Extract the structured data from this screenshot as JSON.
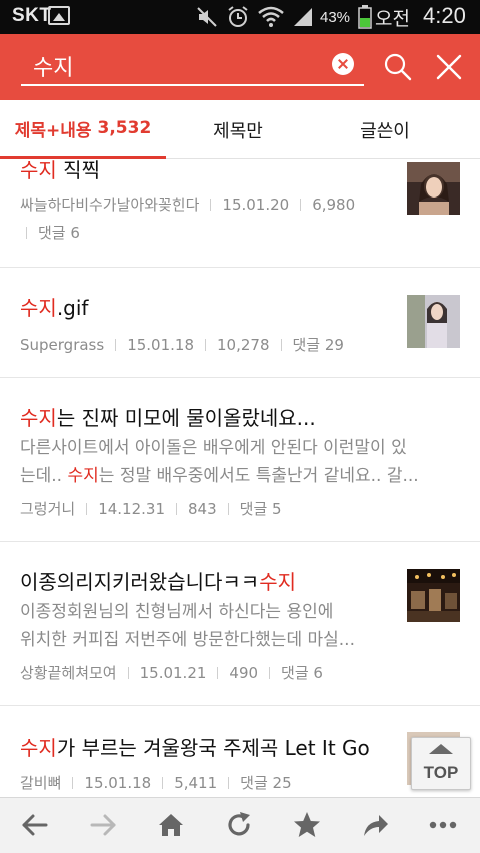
{
  "status_bar": {
    "carrier": "SKT",
    "battery_percent": "43%",
    "ampm": "오전",
    "time": "4:20"
  },
  "search": {
    "query": "수지",
    "icons": {
      "clear": "clear-icon",
      "search": "search-icon",
      "close": "close-icon"
    }
  },
  "tabs": [
    {
      "label": "제목+내용",
      "count": "3,532",
      "active": true
    },
    {
      "label": "제목만",
      "active": false
    },
    {
      "label": "글쓴이",
      "active": false
    }
  ],
  "results": [
    {
      "title_highlight": "수지",
      "title_rest": " 직찍",
      "author": "싸늘하다비수가날아와꽂힌다",
      "date": "15.01.20",
      "views": "6,980",
      "comments": "댓글 6"
    },
    {
      "title_highlight": "수지",
      "title_rest": ".gif",
      "author": "Supergrass",
      "date": "15.01.18",
      "views": "10,278",
      "comments": "댓글 29"
    },
    {
      "title_highlight": "수지",
      "title_rest": "는 진짜 미모에 물이올랐네요...",
      "snippet_line1": "다른사이트에서 아이돌은 배우에게 안된다 이런말이 있",
      "snippet_line2_pre": "는데.. ",
      "snippet_line2_hl": "수지",
      "snippet_line2_post": "는 정말 배우중에서도 특출난거 같네요.. 갈...",
      "author": "그렁거니",
      "date": "14.12.31",
      "views": "843",
      "comments": "댓글 5"
    },
    {
      "title_pre": "이종의리지키러왔습니다ㅋㅋ",
      "title_highlight": "수지",
      "snippet_line1": "이종정회원님의 친형님께서 하신다는 용인에",
      "snippet_line2": "위치한 커피집 저번주에 방문한다했는데 마실...",
      "author": "상황끝헤쳐모여",
      "date": "15.01.21",
      "views": "490",
      "comments": "댓글 6"
    },
    {
      "title_highlight": "수지",
      "title_rest": "가 부르는 겨울왕국 주제곡 Let It Go",
      "author": "갈비뼈",
      "date": "15.01.18",
      "views": "5,411",
      "comments": "댓글 25"
    }
  ],
  "top_button": {
    "label": "TOP"
  },
  "bottom_bar": {
    "icons": [
      "back-icon",
      "forward-icon",
      "home-icon",
      "refresh-icon",
      "bookmark-star-icon",
      "share-icon",
      "more-icon"
    ]
  },
  "colors": {
    "header_bg": "#e74c3f",
    "highlight": "#e02b20",
    "status_bar_bg": "#0b0b0b",
    "bottom_bar_bg": "#f2f2f2"
  }
}
